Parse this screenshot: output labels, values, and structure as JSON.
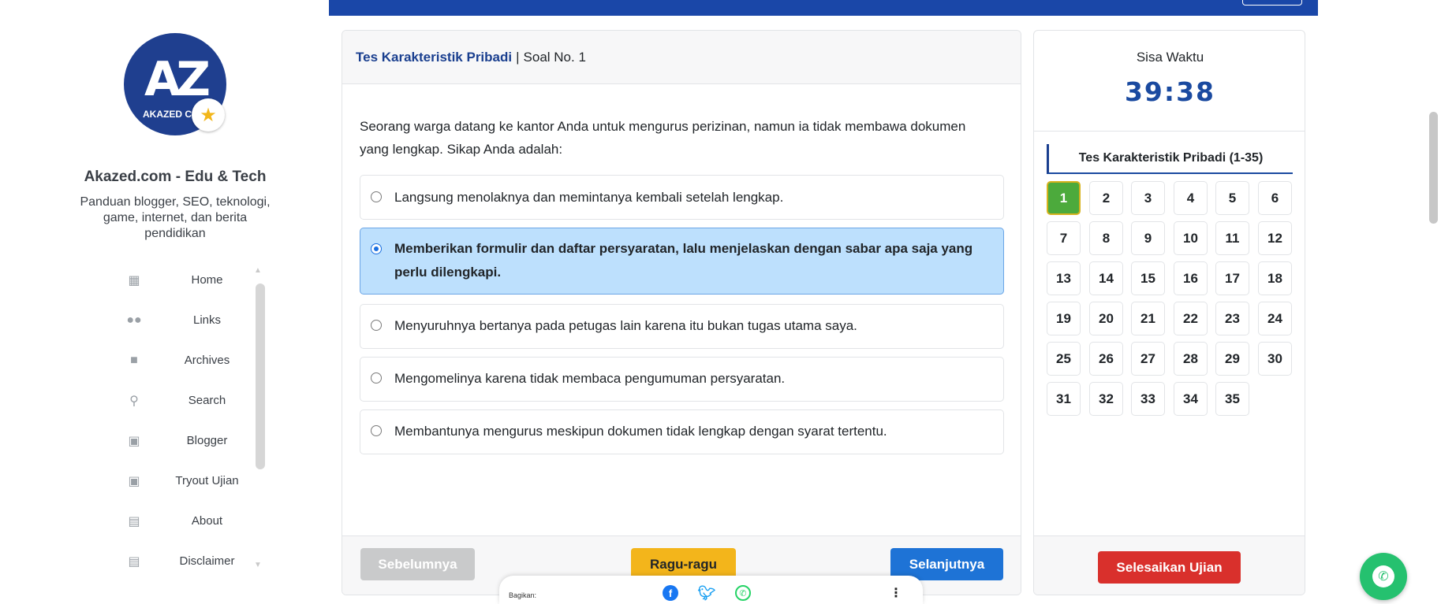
{
  "sidebar": {
    "logo_text": "AZ",
    "logo_caption": "AKAZED C",
    "site_title": "Akazed.com - Edu & Tech",
    "site_description": "Panduan blogger, SEO, teknologi, game, internet, dan berita pendidikan",
    "menu": [
      {
        "label": "Home",
        "icon": "home-icon"
      },
      {
        "label": "Links",
        "icon": "users-icon"
      },
      {
        "label": "Archives",
        "icon": "folder-icon"
      },
      {
        "label": "Search",
        "icon": "search-icon"
      },
      {
        "label": "Blogger",
        "icon": "train-icon"
      },
      {
        "label": "Tryout Ujian",
        "icon": "train-icon"
      },
      {
        "label": "About",
        "icon": "id-card-icon"
      },
      {
        "label": "Disclaimer",
        "icon": "id-card-icon"
      }
    ]
  },
  "question": {
    "section": "Tes Karakteristik Pribadi",
    "separator": "|",
    "number_label": "Soal No. 1",
    "text": "Seorang warga datang ke kantor Anda untuk mengurus perizinan, namun ia tidak membawa dokumen yang lengkap. Sikap Anda adalah:",
    "selected_index": 1,
    "options": [
      "Langsung menolaknya dan memintanya kembali setelah lengkap.",
      "Memberikan formulir dan daftar persyaratan, lalu menjelaskan dengan sabar apa saja yang perlu dilengkapi.",
      "Menyuruhnya bertanya pada petugas lain karena itu bukan tugas utama saya.",
      "Mengomelinya karena tidak membaca pengumuman persyaratan.",
      "Membantunya mengurus meskipun dokumen tidak lengkap dengan syarat tertentu."
    ]
  },
  "buttons": {
    "prev": "Sebelumnya",
    "doubt": "Ragu-ragu",
    "next": "Selanjutnya",
    "finish": "Selesaikan Ujian"
  },
  "share": {
    "label": "Bagikan:",
    "icons": [
      "facebook-icon",
      "twitter-icon",
      "whatsapp-icon",
      "more-vertical-icon"
    ]
  },
  "timer": {
    "label": "Sisa Waktu",
    "value": "39:38"
  },
  "navigator": {
    "title": "Tes Karakteristik Pribadi (1-35)",
    "active": 1,
    "numbers": [
      "1",
      "2",
      "3",
      "4",
      "5",
      "6",
      "7",
      "8",
      "9",
      "10",
      "11",
      "12",
      "13",
      "14",
      "15",
      "16",
      "17",
      "18",
      "19",
      "20",
      "21",
      "22",
      "23",
      "24",
      "25",
      "26",
      "27",
      "28",
      "29",
      "30",
      "31",
      "32",
      "33",
      "34",
      "35"
    ]
  },
  "colors": {
    "primary": "#1a47a8",
    "selected_bg": "#bde0fd",
    "active_number": "#4caa3c",
    "doubt": "#f3b51b",
    "next": "#1e73d6",
    "finish": "#d9302c",
    "whatsapp": "#25c16f"
  }
}
